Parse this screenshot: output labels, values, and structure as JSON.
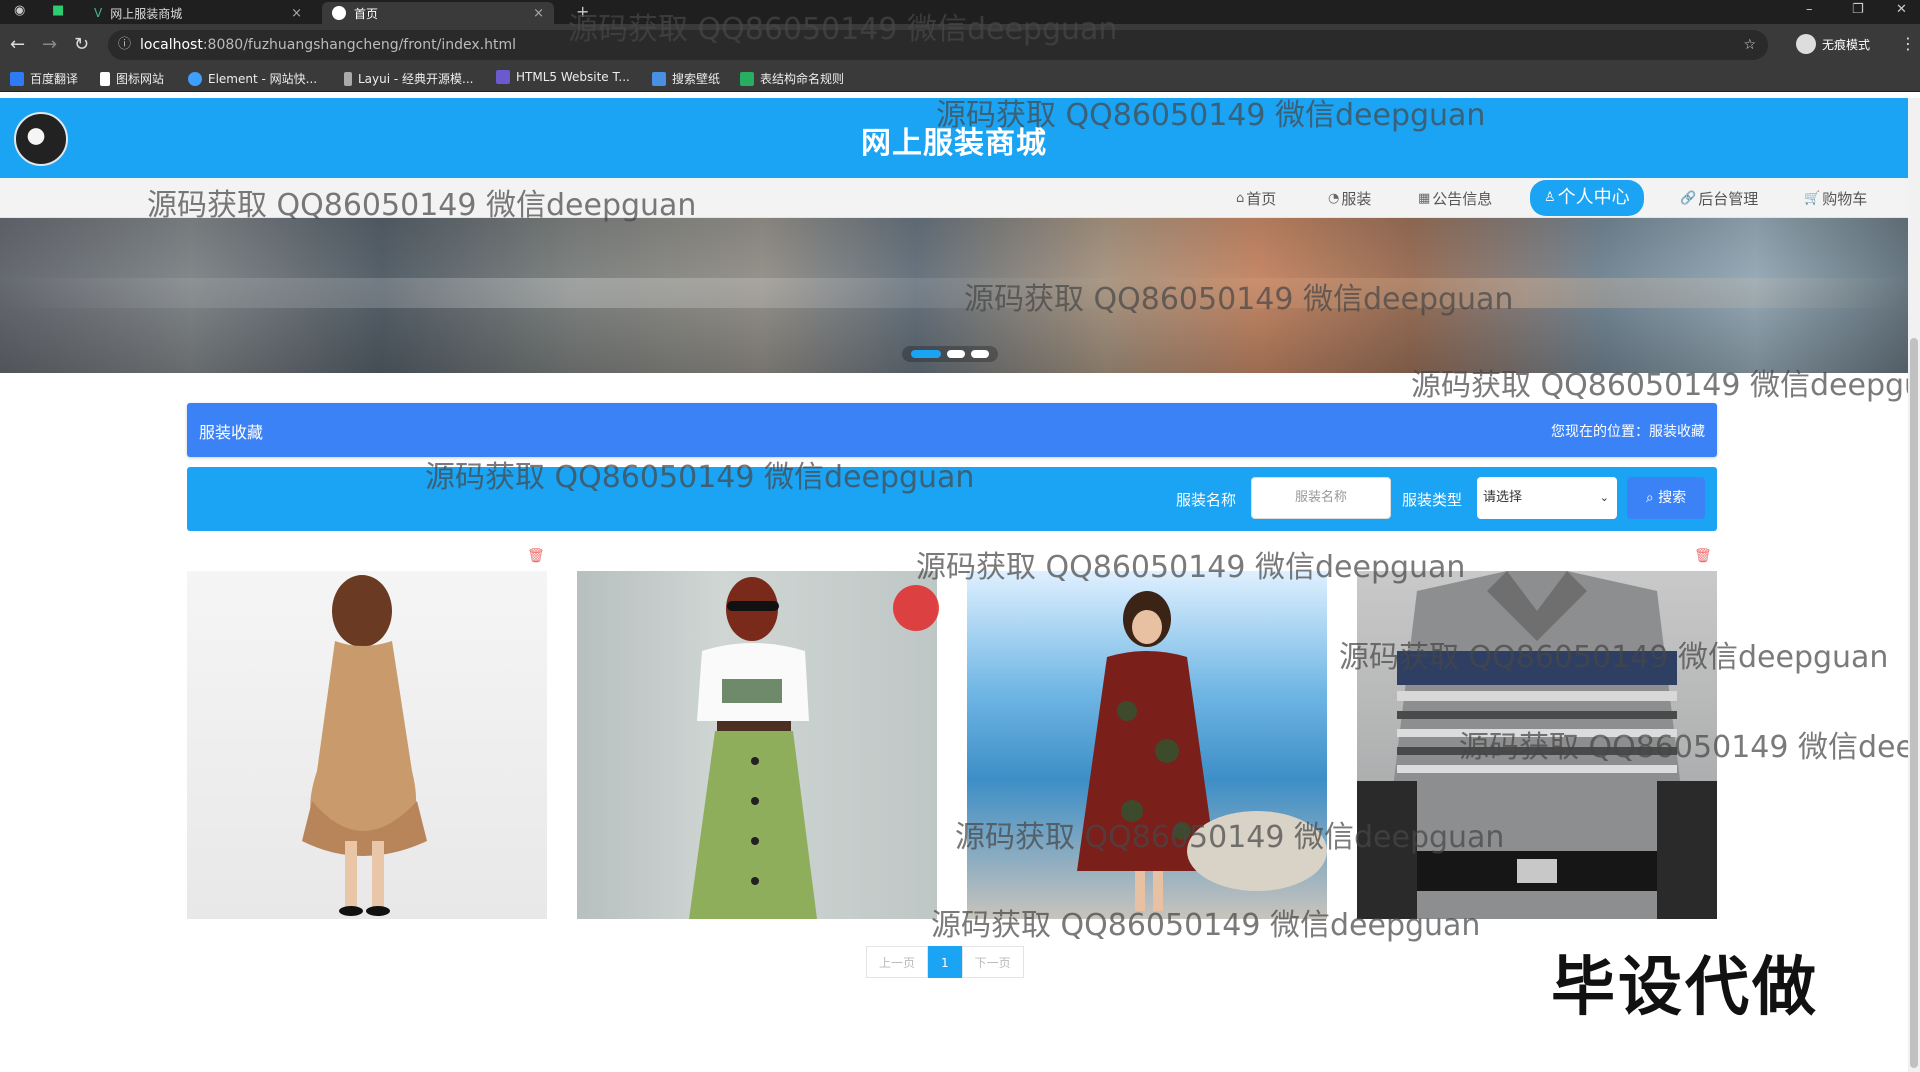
{
  "browser": {
    "tabs": [
      {
        "title": "网上服装商城",
        "active": false
      },
      {
        "title": "首页",
        "active": true
      }
    ],
    "new_tab": "+",
    "url_host": "localhost",
    "url_path": ":8080/fuzhuangshangcheng/front/index.html",
    "incognito_label": "无痕模式",
    "bookmarks": [
      "百度翻译",
      "图标网站",
      "Element - 网站快...",
      "Layui - 经典开源模...",
      "HTML5 Website T...",
      "搜索壁纸",
      "表结构命名规则"
    ]
  },
  "site": {
    "title": "网上服装商城",
    "nav": [
      {
        "label": "首页",
        "icon": "home-icon",
        "glyph": "⌂"
      },
      {
        "label": "服装",
        "icon": "tag-icon",
        "glyph": "◔"
      },
      {
        "label": "公告信息",
        "icon": "notice-icon",
        "glyph": "▦"
      },
      {
        "label": "个人中心",
        "icon": "user-icon",
        "glyph": "♙",
        "active": true
      },
      {
        "label": "后台管理",
        "icon": "link-icon",
        "glyph": "🔗"
      },
      {
        "label": "购物车",
        "icon": "cart-icon",
        "glyph": "🛒"
      }
    ],
    "carousel": {
      "count": 3,
      "active": 0
    }
  },
  "section": {
    "title": "服装收藏",
    "breadcrumb_prefix": "您现在的位置：",
    "breadcrumb_current": "服装收藏"
  },
  "search": {
    "name_label": "服装名称",
    "name_placeholder": "服装名称",
    "type_label": "服装类型",
    "type_selected": "请选择",
    "button": "搜索"
  },
  "pagination": {
    "prev": "上一页",
    "current": "1",
    "next": "下一页"
  },
  "watermarks": [
    "源码获取 QQ86050149 微信deepguan",
    "毕设代做"
  ],
  "colors": {
    "primary": "#1ba4f3",
    "section": "#3b82f6"
  }
}
